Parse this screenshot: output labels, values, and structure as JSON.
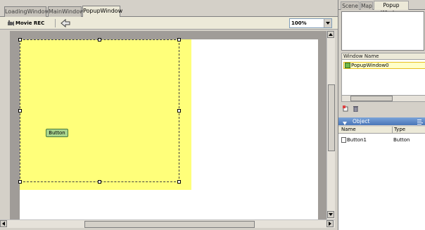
{
  "editor": {
    "tabs": [
      "LoadingWindow",
      "MainWindow",
      "PopupWindow"
    ],
    "active_tab": "PopupWindow",
    "toolbar": {
      "movie_rec_label": "Movie REC",
      "zoom_value": "100%"
    },
    "canvas": {
      "button_label": "Button"
    }
  },
  "panel": {
    "tabs": [
      "Scene",
      "Map",
      "Popup Window"
    ],
    "active_tab": "Popup Window",
    "window_list": {
      "header": "Window Name",
      "items": [
        "PopupWindow0"
      ]
    },
    "object": {
      "title": "Object",
      "columns": [
        "Name",
        "Type"
      ],
      "rows": [
        {
          "name": "Button1",
          "type": "Button"
        }
      ]
    }
  },
  "colors": {
    "popup_fill": "#ffff7a",
    "button_fill": "#a9d58f",
    "object_header": "#4a76b8",
    "selected_item": "#ffffc8"
  }
}
